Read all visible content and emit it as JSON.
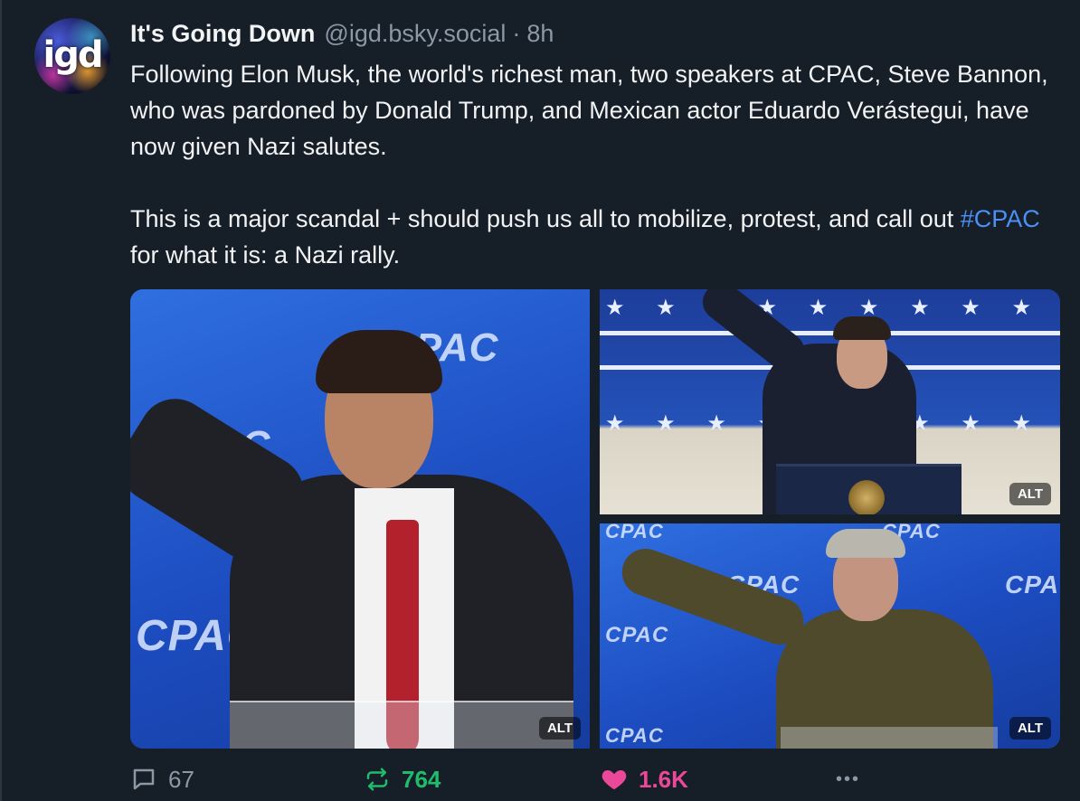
{
  "post": {
    "author": {
      "display_name": "It's Going Down",
      "handle": "@igd.bsky.social",
      "avatar_text": "igd"
    },
    "separator": "·",
    "timestamp": "8h",
    "paragraphs": [
      "Following Elon Musk, the world's richest man, two speakers at CPAC, Steve Bannon, who was pardoned by Donald Trump, and Mexican actor Eduardo Verástegui, have now given Nazi salutes."
    ],
    "paragraph2": {
      "before": "This is a major scandal + should push us all to mobilize, protest, and call out ",
      "hashtag": "#CPAC",
      "after": " for what it is: a Nazi rally."
    },
    "images": [
      {
        "alt_label": "ALT",
        "watermark": "CPAC"
      },
      {
        "alt_label": ""
      },
      {
        "alt_label": "ALT",
        "watermark": "CPAC"
      },
      {
        "alt_label": "ALT",
        "watermark": "CPAC"
      }
    ],
    "actions": {
      "reply_count": "67",
      "repost_count": "764",
      "like_count": "1.6K",
      "more_label": "•••"
    }
  },
  "colors": {
    "background": "#161e27",
    "text": "#f1f3f5",
    "muted": "#8b98a5",
    "link": "#4c8ff6",
    "repost": "#20bc6b",
    "like": "#ec4899",
    "cpac_blue": "#1c4cc0"
  },
  "icons": [
    "reply-icon",
    "repost-icon",
    "heart-icon",
    "more-icon"
  ]
}
